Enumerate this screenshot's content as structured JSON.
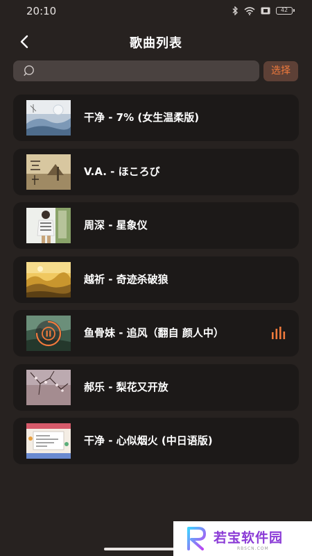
{
  "status_bar": {
    "time": "20:10",
    "battery": "42",
    "icons": [
      "bluetooth-icon",
      "wifi-icon",
      "box-icon",
      "battery-icon"
    ]
  },
  "header": {
    "title": "歌曲列表",
    "back_icon": "chevron-left-icon"
  },
  "search": {
    "placeholder": "",
    "value": "",
    "select_label": "选择"
  },
  "songs": [
    {
      "title": "干净 - 7% (女生温柔版)",
      "playing": false
    },
    {
      "title": "V.A. - ほころび",
      "playing": false
    },
    {
      "title": "周深 - 星象仪",
      "playing": false
    },
    {
      "title": "越祈 - 奇迹杀破狼",
      "playing": false
    },
    {
      "title": "鱼骨妹 - 追风（翻自 颜人中）",
      "playing": true
    },
    {
      "title": "郝乐 - 梨花又开放",
      "playing": false
    },
    {
      "title": "干净 - 心似烟火 (中日语版)",
      "playing": false
    }
  ],
  "watermark": {
    "text": "若宝软件园",
    "sub": "RBSCN.COM"
  },
  "colors": {
    "background": "#272220",
    "card": "#1c1918",
    "accent": "#f07a3c",
    "search_bg": "#4a4240",
    "select_bg": "#5d4036"
  }
}
